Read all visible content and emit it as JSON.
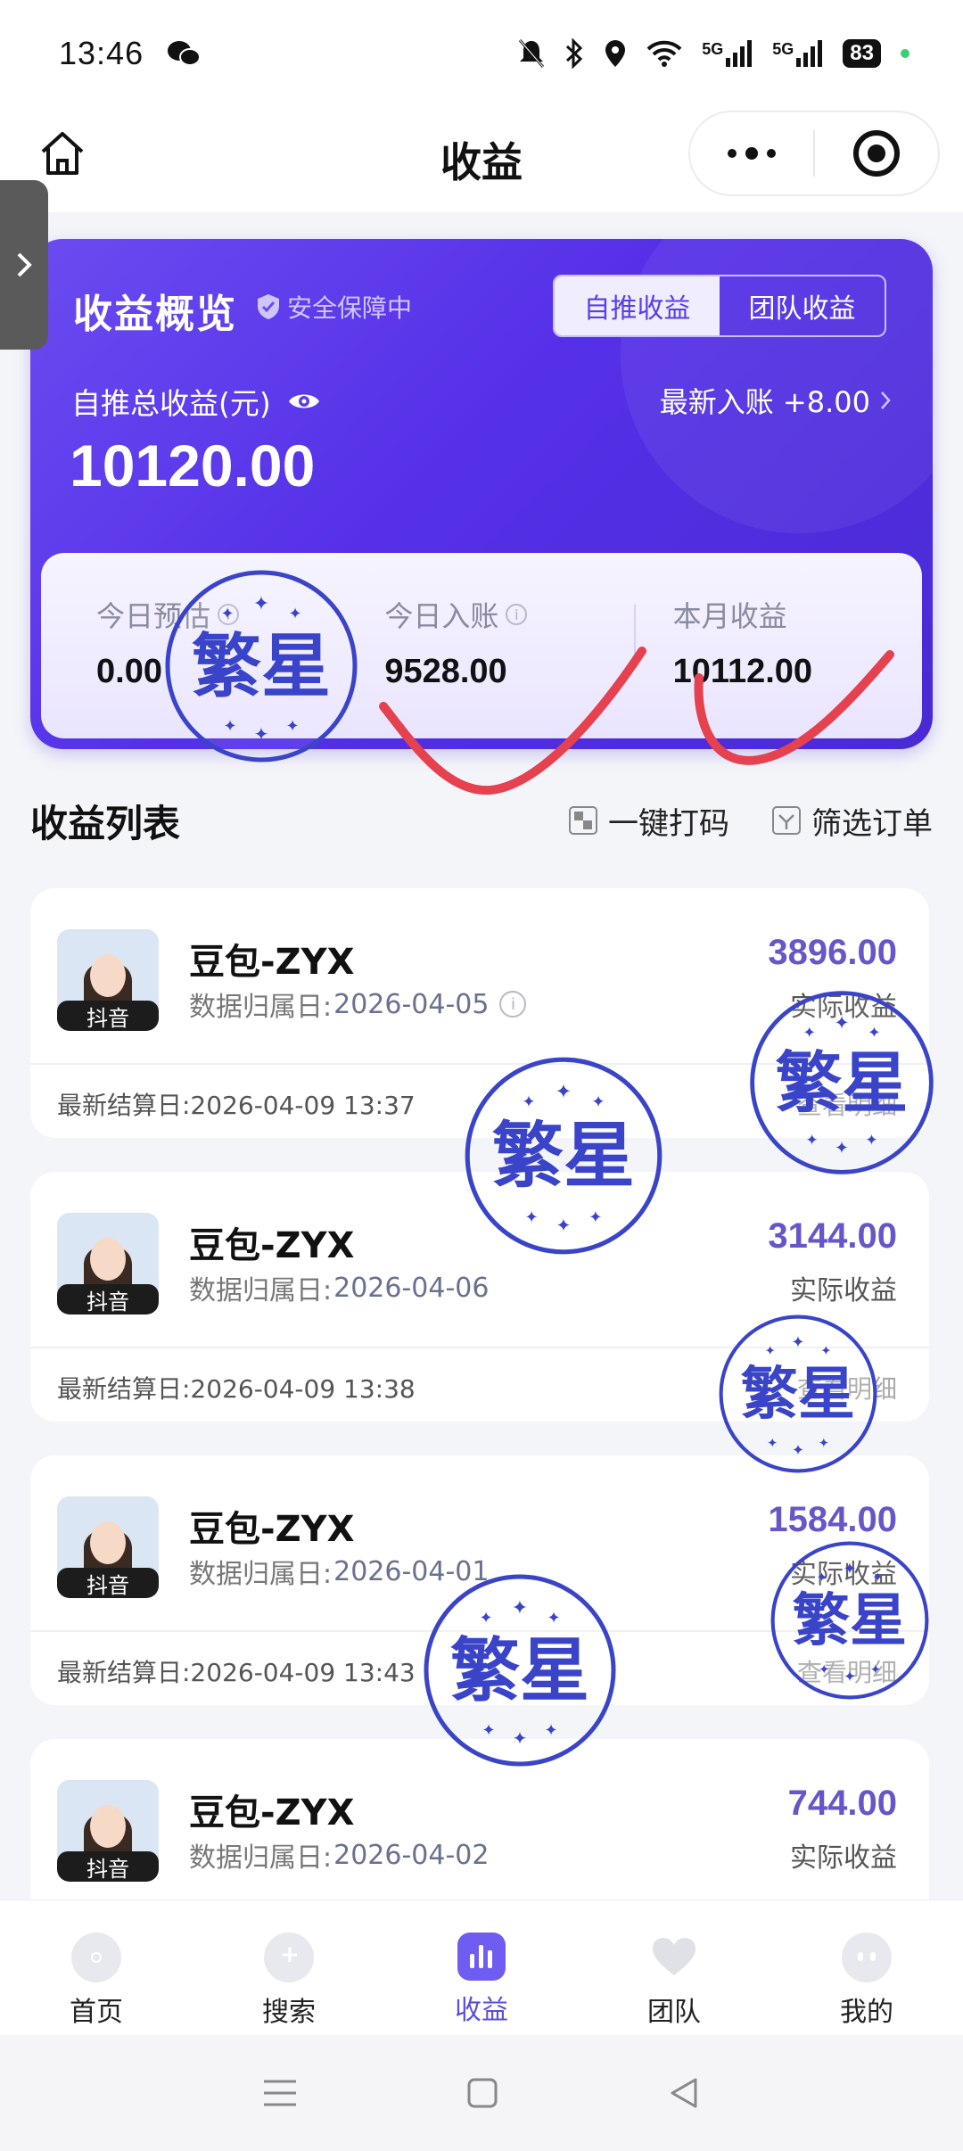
{
  "status_bar": {
    "time": "13:46",
    "battery": "83",
    "signal_1": "5G",
    "signal_2": "5G"
  },
  "header": {
    "title": "收益"
  },
  "overview": {
    "title": "收益概览",
    "safe_label": "安全保障中",
    "tabs": [
      "自推收益",
      "团队收益"
    ],
    "active_tab": 0,
    "total_label": "自推总收益(元)",
    "latest_label": "最新入账 +8.00",
    "total_amount": "10120.00",
    "stats": [
      {
        "label": "今日预估",
        "value": "0.00"
      },
      {
        "label": "今日入账",
        "value": "9528.00"
      },
      {
        "label": "本月收益",
        "value": "10112.00"
      }
    ]
  },
  "list": {
    "title": "收益列表",
    "action_code": "一键打码",
    "action_filter": "筛选订单",
    "items": [
      {
        "name": "豆包-ZYX",
        "date_label": "数据归属日:",
        "date": "2026-04-05",
        "amount": "3896.00",
        "amount_label": "实际收益",
        "settle": "最新结算日:2026-04-09 13:37",
        "detail": "查看明细",
        "tag": "抖音"
      },
      {
        "name": "豆包-ZYX",
        "date_label": "数据归属日:",
        "date": "2026-04-06",
        "amount": "3144.00",
        "amount_label": "实际收益",
        "settle": "最新结算日:2026-04-09 13:38",
        "detail": "查看明细",
        "tag": "抖音"
      },
      {
        "name": "豆包-ZYX",
        "date_label": "数据归属日:",
        "date": "2026-04-01",
        "amount": "1584.00",
        "amount_label": "实际收益",
        "settle": "最新结算日:2026-04-09 13:43",
        "detail": "查看明细",
        "tag": "抖音"
      },
      {
        "name": "豆包-ZYX",
        "date_label": "数据归属日:",
        "date": "2026-04-02",
        "amount": "744.00",
        "amount_label": "实际收益",
        "tag": "抖音"
      }
    ]
  },
  "watermark": {
    "text": "繁星"
  },
  "tabbar": {
    "items": [
      "首页",
      "搜索",
      "收益",
      "团队",
      "我的"
    ],
    "active": 2
  },
  "colors": {
    "accent": "#5530e8",
    "amount": "#6656c8",
    "stamp": "#3a44c8",
    "check": "#e5414f"
  }
}
